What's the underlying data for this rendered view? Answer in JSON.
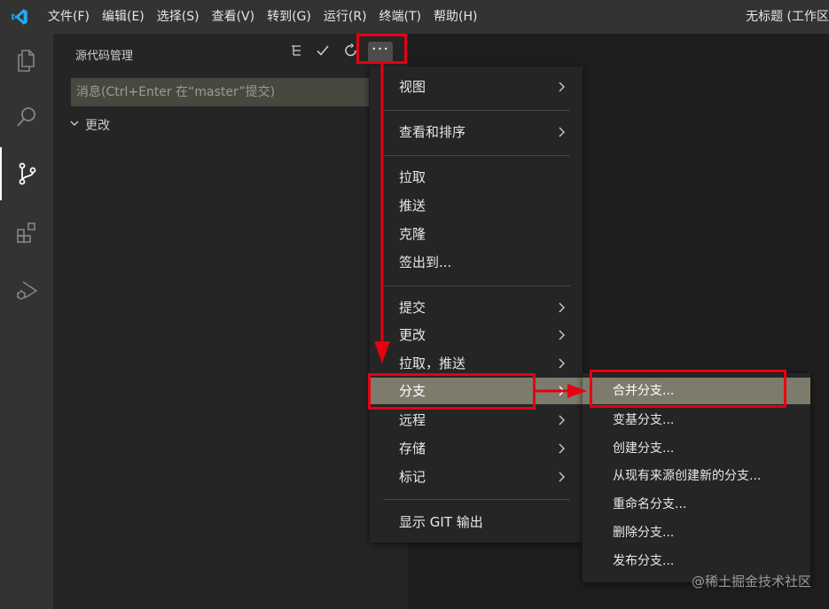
{
  "titlebar": {
    "menus": [
      "文件(F)",
      "编辑(E)",
      "选择(S)",
      "查看(V)",
      "转到(G)",
      "运行(R)",
      "终端(T)",
      "帮助(H)"
    ],
    "window_title": "无标题 (工作区"
  },
  "activitybar": {
    "icons": [
      "explorer-icon",
      "search-icon",
      "source-control-icon",
      "extensions-icon",
      "run-debug-icon"
    ],
    "active": "source-control-icon"
  },
  "sidebar": {
    "title": "源代码管理",
    "actions": [
      "tree-view-icon",
      "check-icon",
      "refresh-icon",
      "more-actions-icon"
    ],
    "more_label": "···",
    "commit_placeholder": "消息(Ctrl+Enter 在“master”提交)",
    "changes_label": "更改"
  },
  "main_menu": {
    "items": [
      {
        "label": "视图",
        "submenu": true
      },
      {
        "label": "查看和排序",
        "submenu": true
      },
      {
        "label": "拉取",
        "submenu": false
      },
      {
        "label": "推送",
        "submenu": false
      },
      {
        "label": "克隆",
        "submenu": false
      },
      {
        "label": "签出到...",
        "submenu": false
      },
      {
        "label": "提交",
        "submenu": true
      },
      {
        "label": "更改",
        "submenu": true
      },
      {
        "label": "拉取，推送",
        "submenu": true
      },
      {
        "label": "分支",
        "submenu": true,
        "highlighted": true
      },
      {
        "label": "远程",
        "submenu": true
      },
      {
        "label": "存储",
        "submenu": true
      },
      {
        "label": "标记",
        "submenu": true
      },
      {
        "label": "显示 GIT 输出",
        "submenu": false
      }
    ]
  },
  "branch_submenu": {
    "items": [
      {
        "label": "合并分支...",
        "highlighted": true
      },
      {
        "label": "变基分支..."
      },
      {
        "label": "创建分支..."
      },
      {
        "label": "从现有来源创建新的分支..."
      },
      {
        "label": "重命名分支..."
      },
      {
        "label": "删除分支..."
      },
      {
        "label": "发布分支..."
      }
    ]
  },
  "watermark": "@稀土掘金技术社区",
  "colors": {
    "annotation_red": "#e60012",
    "highlight": "#7d7b6c",
    "menu_bg": "#252526",
    "vscode_blue": "#23a9f2"
  }
}
